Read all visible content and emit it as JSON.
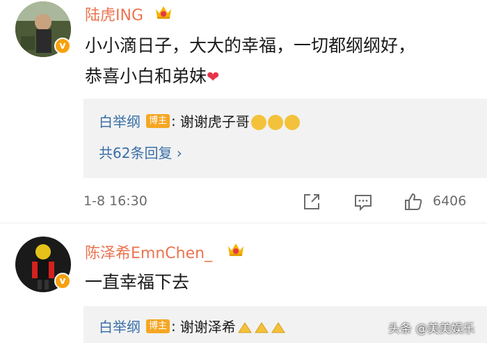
{
  "comments": [
    {
      "username": "陆虎ING",
      "text_line1": "小小滴日子，大大的幸福，一切都纲纲好，",
      "text_line2": "恭喜小白和弟妹",
      "reply": {
        "username": "白举纲",
        "tag": "博主",
        "colon": ":",
        "text": "谢谢虎子哥"
      },
      "more_replies": "共62条回复 ›",
      "timestamp": "1-8 16:30",
      "like_count": "6406"
    },
    {
      "username": "陈泽希EmnChen_",
      "text": "一直幸福下去",
      "reply": {
        "username": "白举纲",
        "tag": "博主",
        "colon": ":",
        "text": "谢谢泽希"
      }
    }
  ],
  "watermark": "头条 @美美娱乐",
  "colors": {
    "username": "#eb7350",
    "link": "#3a6fa8",
    "badge": "#f7a10f",
    "tag": "#f5a623",
    "heart": "#e8354a"
  },
  "icons": [
    "verified-badge-icon",
    "crown-icon",
    "heart-icon",
    "share-icon",
    "comment-icon",
    "like-icon",
    "smile-emoji-icon",
    "clap-emoji-icon"
  ]
}
